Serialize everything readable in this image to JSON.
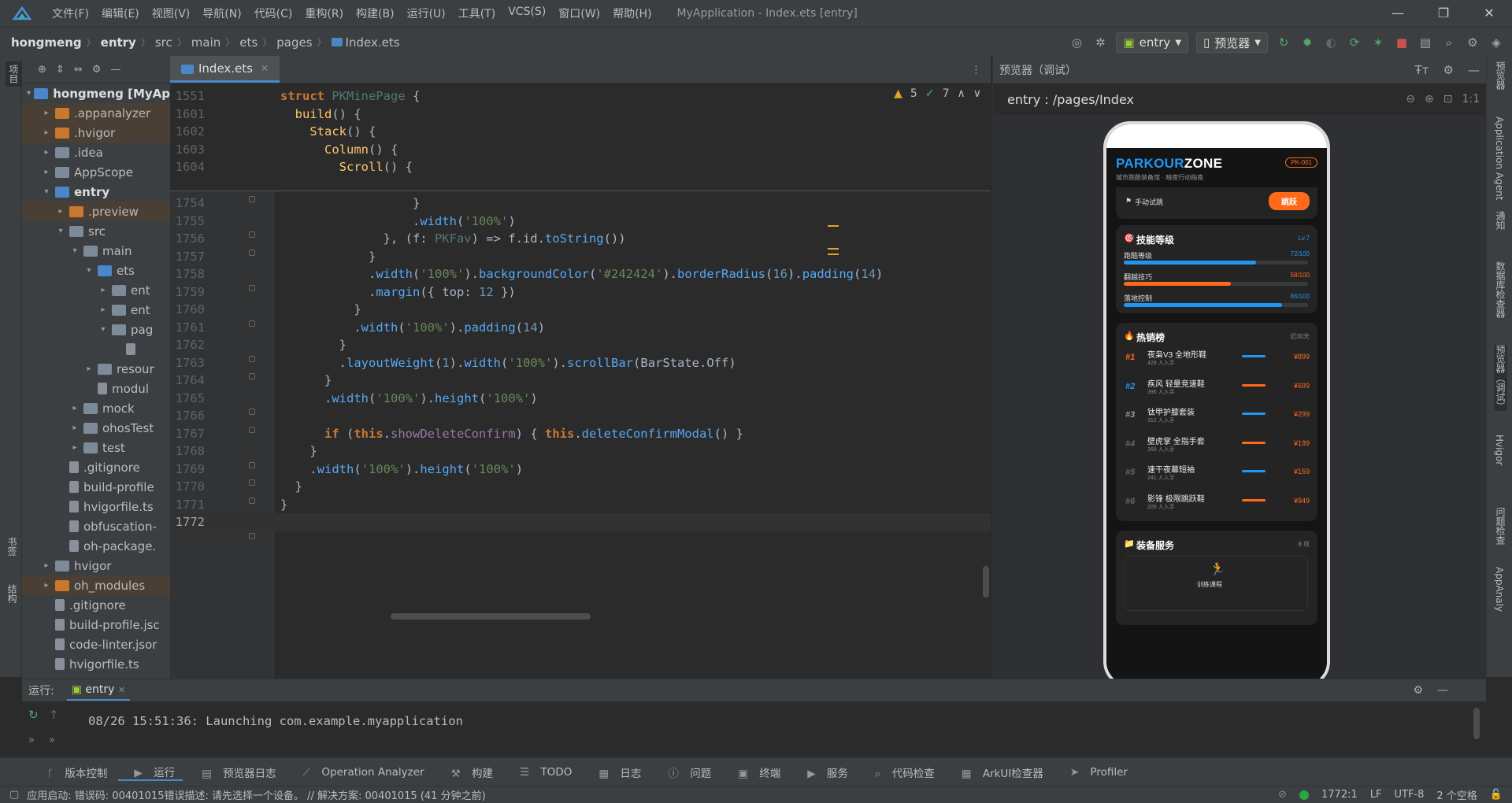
{
  "menubar": {
    "items": [
      "文件(F)",
      "编辑(E)",
      "视图(V)",
      "导航(N)",
      "代码(C)",
      "重构(R)",
      "构建(B)",
      "运行(U)",
      "工具(T)",
      "VCS(S)",
      "窗口(W)",
      "帮助(H)"
    ],
    "window_title": "MyApplication - Index.ets [entry]"
  },
  "breadcrumb": [
    "hongmeng",
    "entry",
    "src",
    "main",
    "ets",
    "pages",
    "Index.ets"
  ],
  "toolbar": {
    "run_config": "entry",
    "device": "预览器"
  },
  "left_strip": {
    "project": "项目",
    "bookmarks": "书签",
    "structure": "结构"
  },
  "project_tree": [
    {
      "label": "hongmeng [MyAp",
      "indent": 0,
      "arrow": "▾",
      "kind": "folder-blue",
      "hl": false,
      "bold": true
    },
    {
      "label": ".appanalyzer",
      "indent": 1,
      "arrow": "▸",
      "kind": "folder-orange",
      "hl": true
    },
    {
      "label": ".hvigor",
      "indent": 1,
      "arrow": "▸",
      "kind": "folder-orange",
      "hl": true
    },
    {
      "label": ".idea",
      "indent": 1,
      "arrow": "▸",
      "kind": "folder",
      "hl": false
    },
    {
      "label": "AppScope",
      "indent": 1,
      "arrow": "▸",
      "kind": "folder",
      "hl": false
    },
    {
      "label": "entry",
      "indent": 1,
      "arrow": "▾",
      "kind": "folder-blue",
      "hl": false,
      "bold": true
    },
    {
      "label": ".preview",
      "indent": 2,
      "arrow": "▸",
      "kind": "folder-orange",
      "hl": true
    },
    {
      "label": "src",
      "indent": 2,
      "arrow": "▾",
      "kind": "folder",
      "hl": false
    },
    {
      "label": "main",
      "indent": 3,
      "arrow": "▾",
      "kind": "folder",
      "hl": false
    },
    {
      "label": "ets",
      "indent": 4,
      "arrow": "▾",
      "kind": "folder-blue",
      "hl": false
    },
    {
      "label": "ent",
      "indent": 5,
      "arrow": "▸",
      "kind": "folder",
      "hl": false
    },
    {
      "label": "ent",
      "indent": 5,
      "arrow": "▸",
      "kind": "folder",
      "hl": false
    },
    {
      "label": "pag",
      "indent": 5,
      "arrow": "▾",
      "kind": "folder",
      "hl": false
    },
    {
      "label": "",
      "indent": 6,
      "arrow": "",
      "kind": "file",
      "hl": false
    },
    {
      "label": "resour",
      "indent": 4,
      "arrow": "▸",
      "kind": "folder",
      "hl": false
    },
    {
      "label": "modul",
      "indent": 4,
      "arrow": "",
      "kind": "file",
      "hl": false
    },
    {
      "label": "mock",
      "indent": 3,
      "arrow": "▸",
      "kind": "folder",
      "hl": false
    },
    {
      "label": "ohosTest",
      "indent": 3,
      "arrow": "▸",
      "kind": "folder",
      "hl": false
    },
    {
      "label": "test",
      "indent": 3,
      "arrow": "▸",
      "kind": "folder",
      "hl": false
    },
    {
      "label": ".gitignore",
      "indent": 2,
      "arrow": "",
      "kind": "file",
      "hl": false
    },
    {
      "label": "build-profile",
      "indent": 2,
      "arrow": "",
      "kind": "file",
      "hl": false
    },
    {
      "label": "hvigorfile.ts",
      "indent": 2,
      "arrow": "",
      "kind": "file",
      "hl": false
    },
    {
      "label": "obfuscation-",
      "indent": 2,
      "arrow": "",
      "kind": "file",
      "hl": false
    },
    {
      "label": "oh-package.",
      "indent": 2,
      "arrow": "",
      "kind": "file",
      "hl": false
    },
    {
      "label": "hvigor",
      "indent": 1,
      "arrow": "▸",
      "kind": "folder",
      "hl": false
    },
    {
      "label": "oh_modules",
      "indent": 1,
      "arrow": "▸",
      "kind": "folder-orange",
      "hl": true
    },
    {
      "label": ".gitignore",
      "indent": 1,
      "arrow": "",
      "kind": "file",
      "hl": false
    },
    {
      "label": "build-profile.jsc",
      "indent": 1,
      "arrow": "",
      "kind": "file",
      "hl": false
    },
    {
      "label": "code-linter.jsor",
      "indent": 1,
      "arrow": "",
      "kind": "file",
      "hl": false
    },
    {
      "label": "hvigorfile.ts",
      "indent": 1,
      "arrow": "",
      "kind": "file",
      "hl": false
    }
  ],
  "editor": {
    "tab": "Index.ets",
    "warnings": "5",
    "checks": "7",
    "sticky_lines": [
      {
        "n": "1551",
        "html": "<span class='kw'>struct</span> <span class='ty'>PKMinePage</span> {"
      },
      {
        "n": "1601",
        "html": "  <span class='fn'>build</span>() {"
      },
      {
        "n": "1602",
        "html": "    <span class='fn'>Stack</span>() {"
      },
      {
        "n": "1603",
        "html": "      <span class='fn'>Column</span>() {"
      },
      {
        "n": "1604",
        "html": "        <span class='fn'>Scroll</span>() {"
      }
    ],
    "lines": [
      {
        "n": "1754",
        "html": "                  }"
      },
      {
        "n": "1755",
        "html": "                  .<span class='fc'>width</span>(<span class='st'>'100%'</span>)"
      },
      {
        "n": "1756",
        "html": "              }, (f: <span class='ty'>PKFav</span>) => f.id.<span class='fc'>toString</span>())"
      },
      {
        "n": "1757",
        "html": "            }"
      },
      {
        "n": "1758",
        "html": "            .<span class='fc'>width</span>(<span class='st'>'100%'</span>).<span class='fc'>backgroundColor</span>(<span class='st'>'#242424'</span>).<span class='fc'>borderRadius</span>(<span class='nu'>16</span>).<span class='fc'>padding</span>(<span class='nu'>14</span>)"
      },
      {
        "n": "1759",
        "html": "            .<span class='fc'>margin</span>({ top: <span class='nu'>12</span> })"
      },
      {
        "n": "1760",
        "html": "          }"
      },
      {
        "n": "1761",
        "html": "          .<span class='fc'>width</span>(<span class='st'>'100%'</span>).<span class='fc'>padding</span>(<span class='nu'>14</span>)"
      },
      {
        "n": "1762",
        "html": "        }"
      },
      {
        "n": "1763",
        "html": "        .<span class='fc'>layoutWeight</span>(<span class='nu'>1</span>).<span class='fc'>width</span>(<span class='st'>'100%'</span>).<span class='fc'>scrollBar</span>(BarState.Off)"
      },
      {
        "n": "1764",
        "html": "      }"
      },
      {
        "n": "1765",
        "html": "      .<span class='fc'>width</span>(<span class='st'>'100%'</span>).<span class='fc'>height</span>(<span class='st'>'100%'</span>)"
      },
      {
        "n": "1766",
        "html": ""
      },
      {
        "n": "1767",
        "html": "      <span class='kw'>if</span> (<span class='kw'>this</span>.<span class='pr'>showDeleteConfirm</span>) { <span class='kw'>this</span>.<span class='fc'>deleteConfirmModal</span>() }"
      },
      {
        "n": "1768",
        "html": "    }"
      },
      {
        "n": "1769",
        "html": "    .<span class='fc'>width</span>(<span class='st'>'100%'</span>).<span class='fc'>height</span>(<span class='st'>'100%'</span>)"
      },
      {
        "n": "1770",
        "html": "  }"
      },
      {
        "n": "1771",
        "html": "}"
      },
      {
        "n": "1772",
        "html": ""
      }
    ]
  },
  "preview": {
    "header": "预览器（调试）",
    "path": "entry : /pages/Index",
    "zoom": "1:1",
    "app": {
      "brand_a": "PARKOUR",
      "brand_b": "ZONE",
      "subtitle": "城市跑酷装备馆 · 暗夜行动指南",
      "badge": "PK-001",
      "trial_label": "手动试跳",
      "trial_button": "跳跃",
      "skills_title": "技能等级",
      "skills_level": "Lv.7",
      "skills": [
        {
          "name": "跑酷等级",
          "value": "72/100",
          "pct": 72,
          "color": "#2196f3"
        },
        {
          "name": "翻越技巧",
          "value": "58/100",
          "pct": 58,
          "color": "#ff6a1a"
        },
        {
          "name": "落地控制",
          "value": "86/100",
          "pct": 86,
          "color": "#2196f3"
        }
      ],
      "rank_title": "热销榜",
      "rank_note": "近30天",
      "rank": [
        {
          "no": "#1",
          "name": "夜枭V3 全地形鞋",
          "people": "428 人入手",
          "price": "¥899",
          "c": "#ff6a1a",
          "lc": "#2196f3"
        },
        {
          "no": "#2",
          "name": "疾风 轻量竞速鞋",
          "people": "396 人入手",
          "price": "¥699",
          "c": "#2196f3",
          "lc": "#ff6a1a"
        },
        {
          "no": "#3",
          "name": "钛甲护膝套装",
          "people": "312 人入手",
          "price": "¥299",
          "c": "#999999",
          "lc": "#2196f3"
        },
        {
          "no": "#4",
          "name": "壁虎掌 全指手套",
          "people": "268 人入手",
          "price": "¥199",
          "c": "#666666",
          "lc": "#ff6a1a"
        },
        {
          "no": "#5",
          "name": "速干夜幕短袖",
          "people": "241 人入手",
          "price": "¥159",
          "c": "#666666",
          "lc": "#2196f3"
        },
        {
          "no": "#6",
          "name": "影锋 极限跳跃鞋",
          "people": "205 人入手",
          "price": "¥949",
          "c": "#666666",
          "lc": "#ff6a1a"
        }
      ],
      "service_title": "装备服务",
      "service_count": "8 项",
      "service_item": "训练课程"
    }
  },
  "right_strip": [
    "预览器",
    "Application Agent",
    "通知",
    "数据库检查器",
    "预览器（调试）",
    "Hvigor",
    "问题检查",
    "AppAnaly"
  ],
  "run": {
    "label": "运行:",
    "tab": "entry",
    "log": "08/26 15:51:36: Launching com.example.myapplication"
  },
  "toolwindows": [
    "版本控制",
    "运行",
    "预览器日志",
    "Operation Analyzer",
    "构建",
    "TODO",
    "日志",
    "问题",
    "终端",
    "服务",
    "代码检查",
    "ArkUI检查器",
    "Profiler"
  ],
  "status": {
    "message": "应用启动: 错误码: 00401015错误描述: 请先选择一个设备。 // 解决方案: 00401015 (41 分钟之前)",
    "position": "1772:1",
    "line_sep": "LF",
    "encoding": "UTF-8",
    "indent": "2 个空格"
  },
  "colors": {
    "accent_blue": "#2196f3",
    "accent_orange": "#ff6a1a",
    "card_bg": "#242424"
  }
}
